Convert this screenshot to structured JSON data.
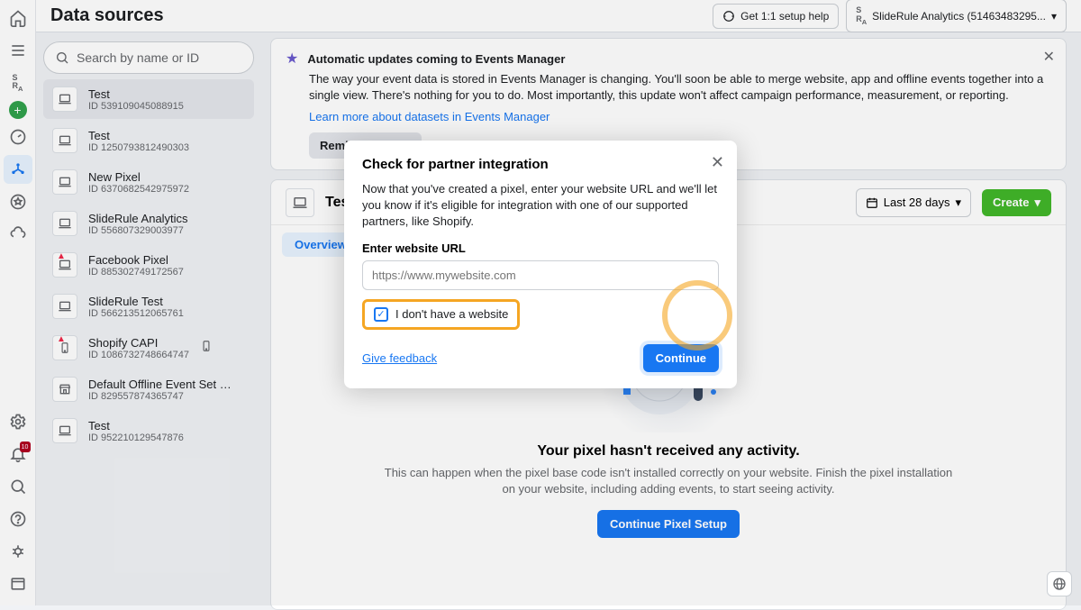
{
  "page_title": "Data sources",
  "topbar": {
    "help_label": "Get 1:1 setup help",
    "account_label": "SlideRule Analytics (51463483295..."
  },
  "search_placeholder": "Search by name or ID",
  "datasources": [
    {
      "name": "Test",
      "id": "ID 539109045088915",
      "icon": "laptop"
    },
    {
      "name": "Test",
      "id": "ID 1250793812490303",
      "icon": "laptop"
    },
    {
      "name": "New Pixel",
      "id": "ID 6370682542975972",
      "icon": "laptop"
    },
    {
      "name": "SlideRule Analytics",
      "id": "ID 556807329003977",
      "icon": "laptop"
    },
    {
      "name": "Facebook Pixel",
      "id": "ID 885302749172567",
      "icon": "laptop",
      "warn": true
    },
    {
      "name": "SlideRule Test",
      "id": "ID 566213512065761",
      "icon": "laptop"
    },
    {
      "name": "Shopify CAPI",
      "id": "ID 1086732748664747",
      "icon": "phone",
      "warn": true,
      "mobile": true
    },
    {
      "name": "Default Offline Event Set For ...",
      "id": "ID 829557874365747",
      "icon": "store"
    },
    {
      "name": "Test",
      "id": "ID 952210129547876",
      "icon": "laptop"
    }
  ],
  "banner": {
    "title": "Automatic updates coming to Events Manager",
    "desc": "The way your event data is stored in Events Manager is changing. You'll soon be able to merge website, app and offline events together into a single view. There's nothing for you to do. Most importantly, this update won't affect campaign performance, measurement, or reporting.",
    "link": "Learn more about datasets in Events Manager",
    "remind": "Remind me later"
  },
  "content": {
    "title": "Test",
    "date_label": "Last 28 days",
    "create_label": "Create",
    "tab_overview": "Overview",
    "empty_title": "Your pixel hasn't received any activity.",
    "empty_desc": "This can happen when the pixel base code isn't installed correctly on your website. Finish the pixel installation on your website, including adding events, to start seeing activity.",
    "empty_cta": "Continue Pixel Setup"
  },
  "modal": {
    "title": "Check for partner integration",
    "desc": "Now that you've created a pixel, enter your website URL and we'll let you know if it's eligible for integration with one of our supported partners, like Shopify.",
    "url_label": "Enter website URL",
    "url_placeholder": "https://www.mywebsite.com",
    "checkbox_label": "I don't have a website",
    "feedback": "Give feedback",
    "continue": "Continue"
  },
  "notif_badge": "10"
}
